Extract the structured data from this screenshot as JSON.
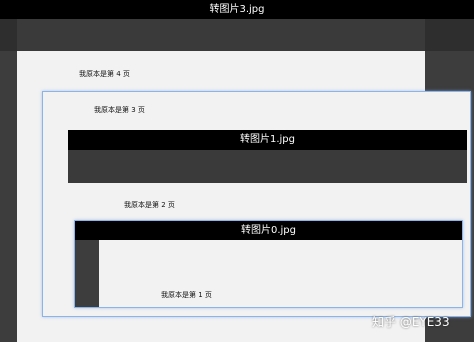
{
  "viewer_3": {
    "title": "转图片3.jpg",
    "page_caption": "我原本是第 4 页"
  },
  "viewer_2": {
    "page_caption": "我原本是第 3 页"
  },
  "viewer_1": {
    "title": "转图片1.jpg",
    "page_caption": "我原本是第 2 页"
  },
  "viewer_0": {
    "title": "转图片0.jpg",
    "page_caption": "我原本是第 1 页"
  },
  "watermark": {
    "text": "知乎 @EYE33"
  }
}
